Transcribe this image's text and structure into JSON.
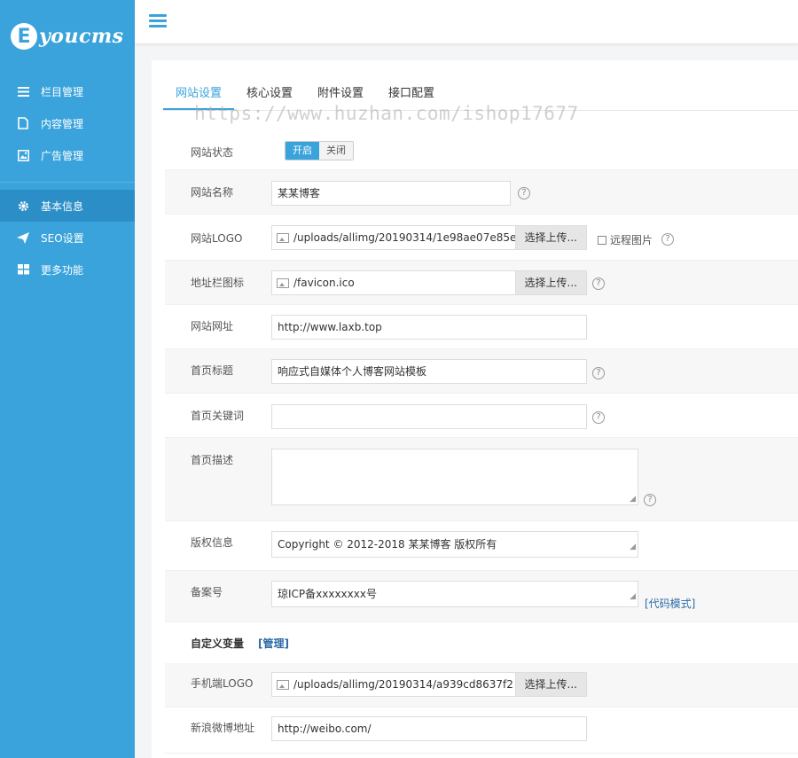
{
  "brand": {
    "letter": "E",
    "name": "youcms"
  },
  "sidebar": {
    "items": [
      {
        "label": "栏目管理",
        "icon": "list-icon"
      },
      {
        "label": "内容管理",
        "icon": "document-icon"
      },
      {
        "label": "广告管理",
        "icon": "image-icon"
      },
      {
        "label": "基本信息",
        "icon": "gear-icon",
        "active": true
      },
      {
        "label": "SEO设置",
        "icon": "send-icon"
      },
      {
        "label": "更多功能",
        "icon": "grid-icon"
      }
    ]
  },
  "tabs": [
    "网站设置",
    "核心设置",
    "附件设置",
    "接口配置"
  ],
  "watermark": "https://www.huzhan.com/ishop17677",
  "form": {
    "status": {
      "label": "网站状态",
      "on": "开启",
      "off": "关闭"
    },
    "site_name": {
      "label": "网站名称",
      "value": "某某博客"
    },
    "site_logo": {
      "label": "网站LOGO",
      "value": "/uploads/allimg/20190314/1e98ae07e85e",
      "upload": "选择上传...",
      "remote": "远程图片"
    },
    "favicon": {
      "label": "地址栏图标",
      "value": "/favicon.ico",
      "upload": "选择上传..."
    },
    "site_url": {
      "label": "网站网址",
      "value": "http://www.laxb.top"
    },
    "home_title": {
      "label": "首页标题",
      "value": "响应式自媒体个人博客网站模板"
    },
    "home_keywords": {
      "label": "首页关键词",
      "value": ""
    },
    "home_desc": {
      "label": "首页描述",
      "value": ""
    },
    "copyright": {
      "label": "版权信息",
      "value": "Copyright © 2012-2018 某某博客 版权所有"
    },
    "icp": {
      "label": "备案号",
      "value": "琼ICP备xxxxxxxx号",
      "code_mode": "[代码模式]"
    },
    "custom_vars": {
      "title": "自定义变量",
      "manage": "[管理]"
    },
    "mobile_logo": {
      "label": "手机端LOGO",
      "value": "/uploads/allimg/20190314/a939cd8637f2",
      "upload": "选择上传..."
    },
    "weibo": {
      "label": "新浪微博地址",
      "value": "http://weibo.com/"
    }
  },
  "colors": {
    "accent": "#3aa3db",
    "sidebar_active": "#2c8ec7",
    "link": "#2b6aa6"
  }
}
